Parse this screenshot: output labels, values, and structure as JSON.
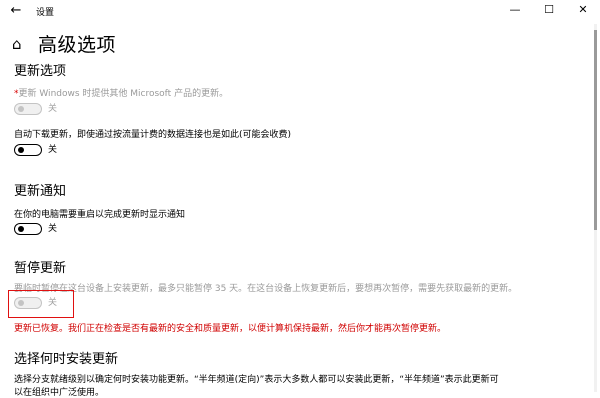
{
  "titlebar": {
    "back_glyph": "←",
    "app_title": "设置",
    "minimize_glyph": "—",
    "maximize_glyph": "☐",
    "close_glyph": "✕"
  },
  "header": {
    "home_glyph": "⌂",
    "title": "高级选项"
  },
  "update_options": {
    "title": "更新选项",
    "microsoft_products": {
      "marker": "*",
      "label": "更新 Windows 时提供其他 Microsoft 产品的更新。",
      "state": "关",
      "enabled": false
    },
    "metered_download": {
      "label": "自动下载更新，即使通过按流量计费的数据连接也是如此(可能会收费)",
      "state": "关"
    }
  },
  "update_notifications": {
    "title": "更新通知",
    "restart_notice": {
      "label": "在你的电脑需要重启以完成更新时显示通知",
      "state": "关"
    }
  },
  "pause_updates": {
    "title": "暂停更新",
    "description": "要临时暂停在这台设备上安装更新，最多只能暂停 35 天。在这台设备上恢复更新后，要想再次暂停，需要先获取最新的更新。",
    "state": "关",
    "enabled": false,
    "warning": "更新已恢复。我们正在检查是否有最新的安全和质量更新，以便计算机保持最新，然后你才能再次暂停更新。"
  },
  "install_time": {
    "title": "选择何时安装更新",
    "line1": "选择分支就绪级别以确定何时安装功能更新。“半年频道(定向)”表示大多数人都可以安装此更新，“半年频道”表示此更新可",
    "line2": "以在组织中广泛使用。"
  },
  "colors": {
    "warning_red": "#d00000",
    "highlight_border": "#e01010",
    "disabled_gray": "#9a9a9a"
  }
}
